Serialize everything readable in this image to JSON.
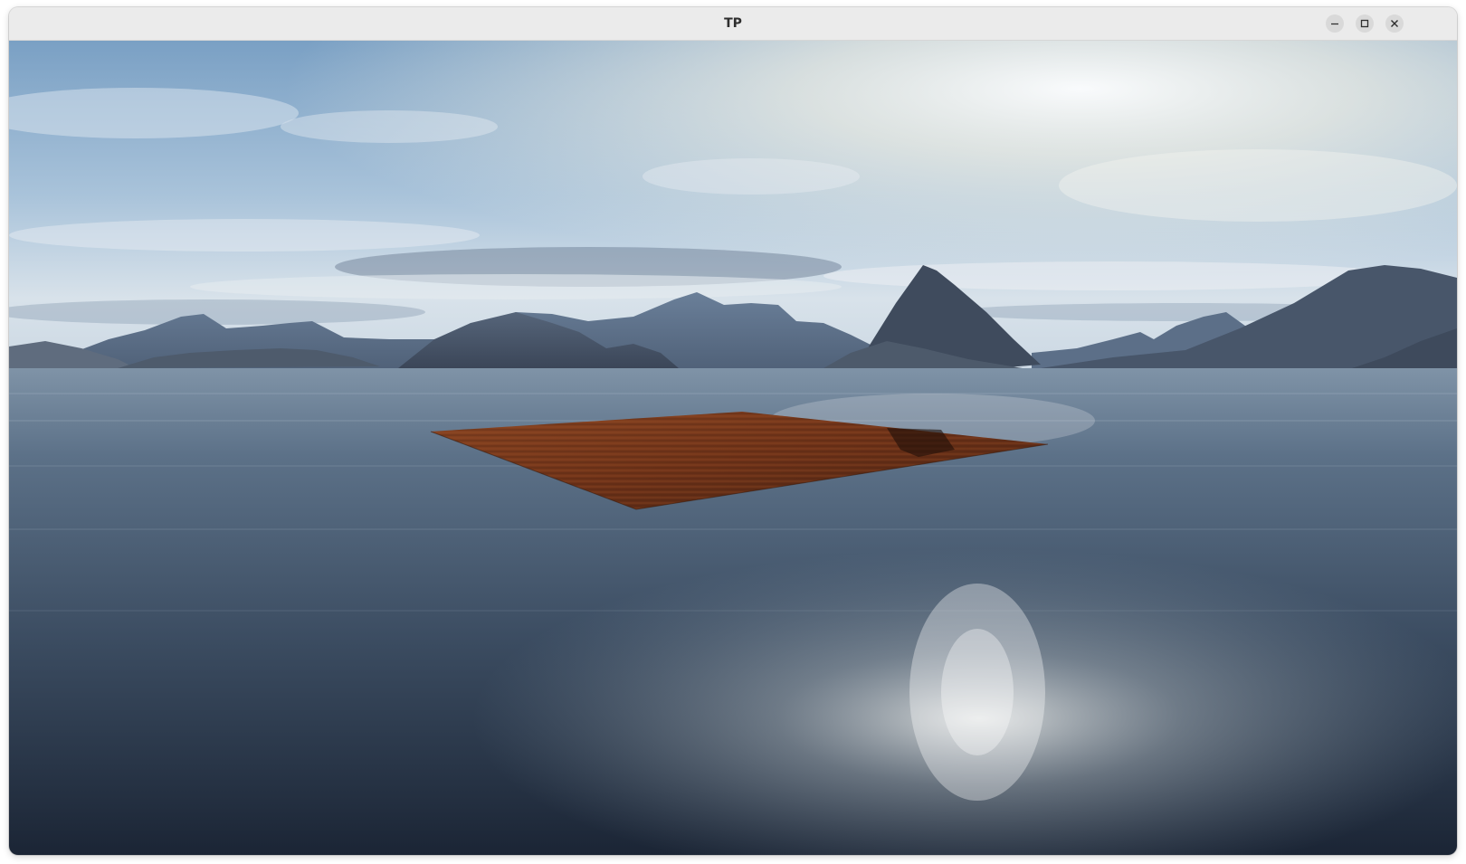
{
  "window": {
    "title": "TP"
  },
  "titlebar_buttons": [
    {
      "name": "minimize-button",
      "icon": "minimize-icon"
    },
    {
      "name": "maximize-button",
      "icon": "maximize-icon"
    },
    {
      "name": "close-button",
      "icon": "close-icon"
    }
  ],
  "scene": {
    "description_icons": [
      "sky",
      "mountains",
      "water",
      "wooden-plane"
    ],
    "colors": {
      "sky_top": "#6f97bf",
      "sky_bright": "#f4f3ea",
      "mountain": "#4b5a6e",
      "water_dark": "#1d2a3b",
      "water_mid": "#5a7088",
      "plane": "#7a3a1c"
    }
  }
}
